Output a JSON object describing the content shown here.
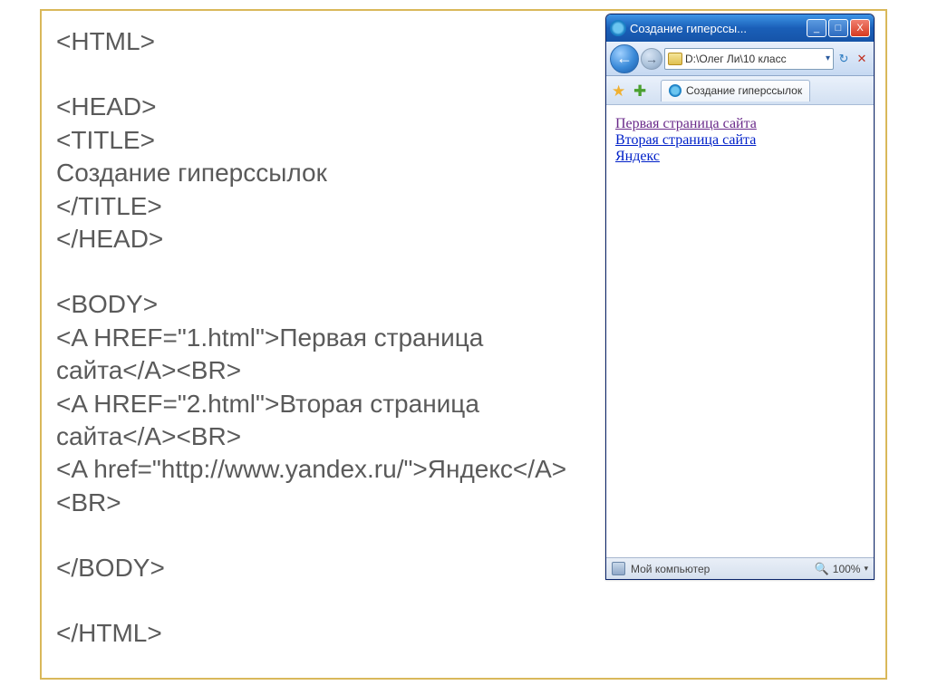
{
  "code": {
    "l1": "<HTML>",
    "l2": "<HEAD>",
    "l3": "<TITLE>",
    "l4": "Создание гиперссылок",
    "l5": "</TITLE>",
    "l6": "</HEAD>",
    "l7": "<BODY>",
    "l8": "<A HREF=\"1.html\">Первая страница сайта</A><BR>",
    "l9": "<A HREF=\"2.html\">Вторая страница сайта</A><BR>",
    "l10": "<A href=\"http://www.yandex.ru/\">Яндекс</A><BR>",
    "l11": "</BODY>",
    "l12": "</HTML>"
  },
  "browser": {
    "title": "Создание гиперссы...",
    "address": "D:\\Олег Ли\\10 класс",
    "tab_label": "Создание гиперссылок",
    "links": {
      "a1": "Первая страница сайта",
      "a2": "Вторая страница сайта",
      "a3": "Яндекс"
    },
    "status_left": "Мой компьютер",
    "status_zoom": "100%"
  },
  "win_buttons": {
    "min": "_",
    "max": "□",
    "close": "X"
  },
  "nav_glyph": {
    "back": "←",
    "fwd": "→",
    "refresh": "↻",
    "stop": "✕",
    "dd": "▾"
  },
  "icons": {
    "star": "★",
    "plus": "✚",
    "mag": "🔍"
  }
}
